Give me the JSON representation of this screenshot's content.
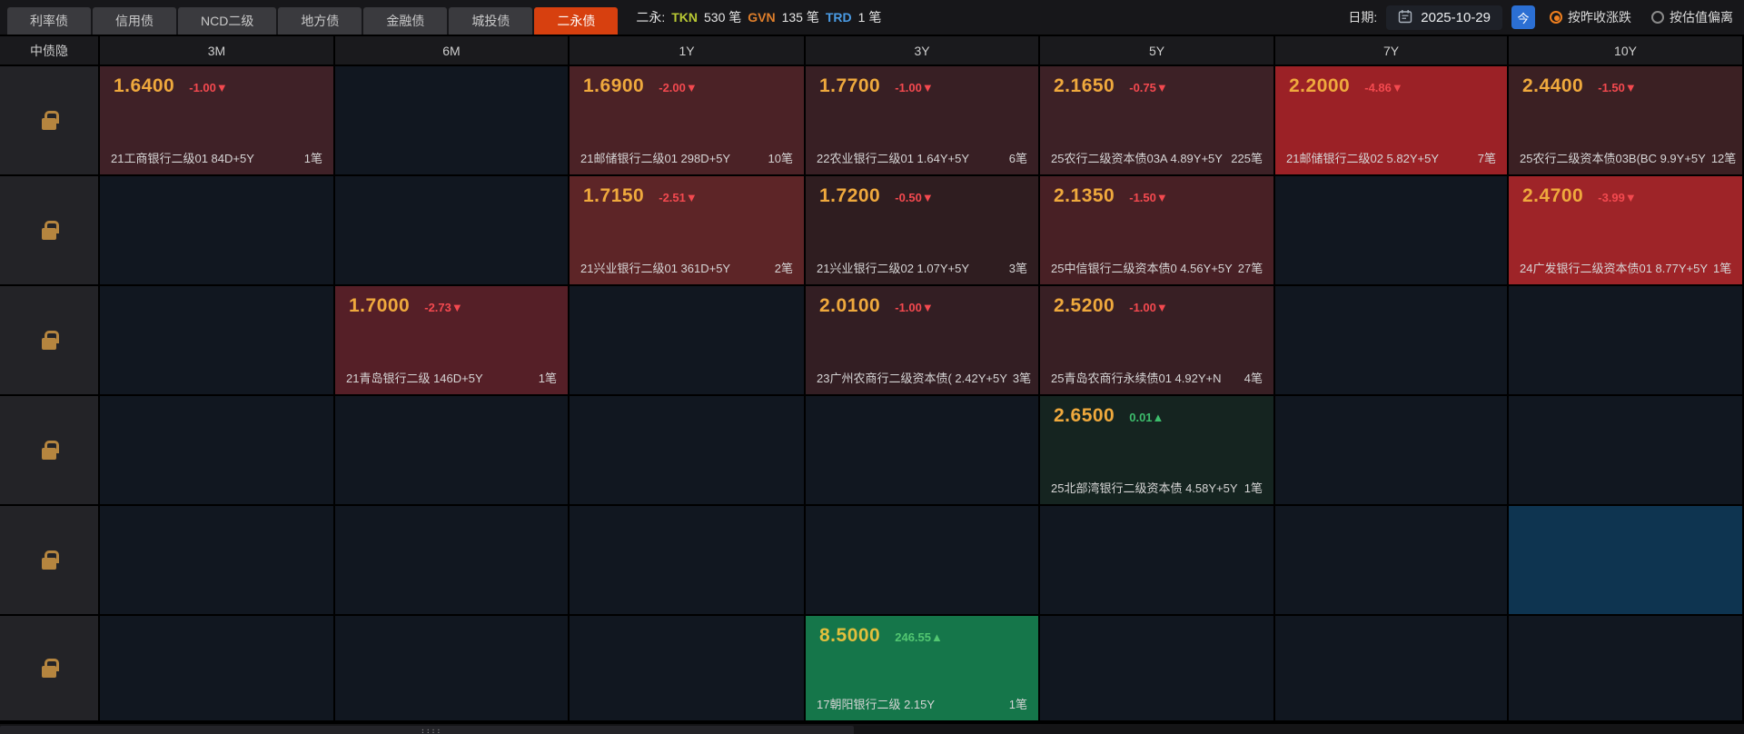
{
  "topbar": {
    "tabs": [
      {
        "id": "rates",
        "label": "利率债",
        "selected": false
      },
      {
        "id": "credit",
        "label": "信用债",
        "selected": false
      },
      {
        "id": "ncd",
        "label": "NCD二级",
        "selected": false
      },
      {
        "id": "local-gov",
        "label": "地方债",
        "selected": false
      },
      {
        "id": "financial",
        "label": "金融债",
        "selected": false
      },
      {
        "id": "urban",
        "label": "城投债",
        "selected": false
      },
      {
        "id": "er-yong",
        "label": "二永债",
        "selected": true
      }
    ],
    "stats": {
      "prefix": "二永:",
      "items": [
        {
          "label": "TKN",
          "count": "530",
          "unit": "笔",
          "color": "#b9c934"
        },
        {
          "label": "GVN",
          "count": "135",
          "unit": "笔",
          "color": "#e07f2b"
        },
        {
          "label": "TRD",
          "count": "1",
          "unit": "笔",
          "color": "#4a9be4"
        }
      ]
    },
    "date": {
      "label": "日期:",
      "value": "2025-10-29",
      "today_label": "今"
    },
    "radios": [
      {
        "label": "按昨收涨跌",
        "selected": true
      },
      {
        "label": "按估值偏离",
        "selected": false
      }
    ]
  },
  "grid": {
    "corner_label": "中债隐",
    "columns": [
      "3M",
      "6M",
      "1Y",
      "3Y",
      "5Y",
      "7Y",
      "10Y"
    ],
    "rows": [
      [
        {
          "value": "1.6400",
          "change": "-1.00",
          "dir": "down",
          "name": "21工商银行二级01 84D+5Y",
          "count": "1笔",
          "bg": "#3f2127"
        },
        null,
        {
          "value": "1.6900",
          "change": "-2.00",
          "dir": "down",
          "name": "21邮储银行二级01 298D+5Y",
          "count": "10笔",
          "bg": "#4b2226"
        },
        {
          "value": "1.7700",
          "change": "-1.00",
          "dir": "down",
          "name": "22农业银行二级01 1.64Y+5Y",
          "count": "6笔",
          "bg": "#381f24"
        },
        {
          "value": "2.1650",
          "change": "-0.75",
          "dir": "down",
          "name": "25农行二级资本债03A 4.89Y+5Y",
          "count": "225笔",
          "bg": "#3d2126"
        },
        {
          "value": "2.2000",
          "change": "-4.86",
          "dir": "down",
          "name": "21邮储银行二级02 5.82Y+5Y",
          "count": "7笔",
          "bg": "#9b2126"
        },
        {
          "value": "2.4400",
          "change": "-1.50",
          "dir": "down",
          "name": "25农行二级资本债03B(BC 9.9Y+5Y",
          "count": "12笔",
          "bg": "#3b2023"
        }
      ],
      [
        null,
        null,
        {
          "value": "1.7150",
          "change": "-2.51",
          "dir": "down",
          "name": "21兴业银行二级01 361D+5Y",
          "count": "2笔",
          "bg": "#5d2527"
        },
        {
          "value": "1.7200",
          "change": "-0.50",
          "dir": "down",
          "name": "21兴业银行二级02 1.07Y+5Y",
          "count": "3笔",
          "bg": "#2f1d20"
        },
        {
          "value": "2.1350",
          "change": "-1.50",
          "dir": "down",
          "name": "25中信银行二级资本债0 4.56Y+5Y",
          "count": "27笔",
          "bg": "#482025"
        },
        null,
        {
          "value": "2.4700",
          "change": "-3.99",
          "dir": "down",
          "name": "24广发银行二级资本债01 8.77Y+5Y",
          "count": "1笔",
          "bg": "#9e2428"
        }
      ],
      [
        null,
        {
          "value": "1.7000",
          "change": "-2.73",
          "dir": "down",
          "name": "21青岛银行二级 146D+5Y",
          "count": "1笔",
          "bg": "#551f27"
        },
        null,
        {
          "value": "2.0100",
          "change": "-1.00",
          "dir": "down",
          "name": "23广州农商行二级资本债( 2.42Y+5Y",
          "count": "3笔",
          "bg": "#331e23"
        },
        {
          "value": "2.5200",
          "change": "-1.00",
          "dir": "down",
          "name": "25青岛农商行永续债01 4.92Y+N",
          "count": "4笔",
          "bg": "#381f24"
        },
        null,
        null
      ],
      [
        null,
        null,
        null,
        null,
        {
          "value": "2.6500",
          "change": "0.01",
          "dir": "up",
          "name": "25北部湾银行二级资本债 4.58Y+5Y",
          "count": "1笔",
          "bg": "#152420"
        },
        null,
        null
      ],
      [
        null,
        null,
        null,
        null,
        null,
        null,
        {
          "bg": "#0e3450"
        }
      ],
      [
        null,
        null,
        null,
        {
          "value": "8.5000",
          "change": "246.55",
          "dir": "up",
          "name": "17朝阳银行二级 2.15Y",
          "count": "1笔",
          "bg": "#15764a",
          "value_color": "#e2bf3d",
          "change_color": "#52c671"
        },
        null,
        null,
        null
      ]
    ]
  },
  "scrollbar": {
    "grip": "::::"
  },
  "colors": {
    "tab_selected": "#d7400f",
    "value_gold": "#efa93d",
    "change_down_red": "#f3494f",
    "change_up_green": "#3dbd6c",
    "highlight_blue": "#0e3450",
    "lock_gold": "#b5853f",
    "today_button_blue": "#2b6fd3",
    "radio_orange": "#ef7f1f"
  }
}
